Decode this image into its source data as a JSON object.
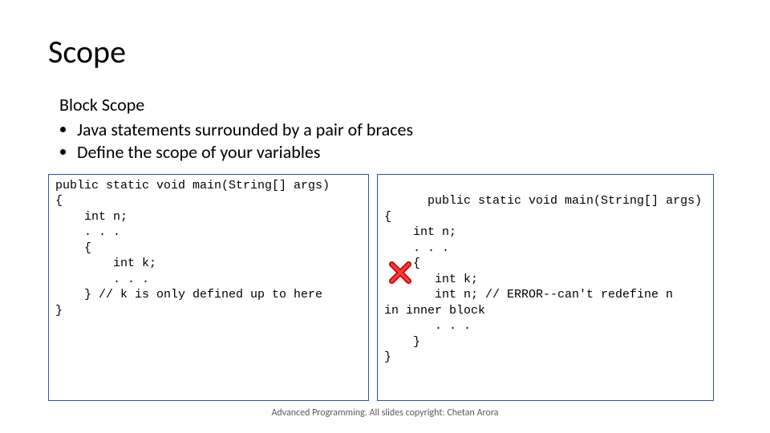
{
  "title": "Scope",
  "subhead": "Block Scope",
  "bullets": [
    "Java statements surrounded by a pair of braces",
    "Define the scope of your variables"
  ],
  "code_left": "public static void main(String[] args)\n{\n    int n;\n    . . .\n    {\n        int k;\n        . . .\n    } // k is only defined up to here\n}",
  "code_right": "public static void main(String[] args)\n{\n    int n;\n    . . .\n    {\n       int k;\n       int n; // ERROR--can't redefine n\nin inner block\n       . . .\n    }\n}",
  "footer": "Advanced Programming. All slides copyright: Chetan Arora"
}
